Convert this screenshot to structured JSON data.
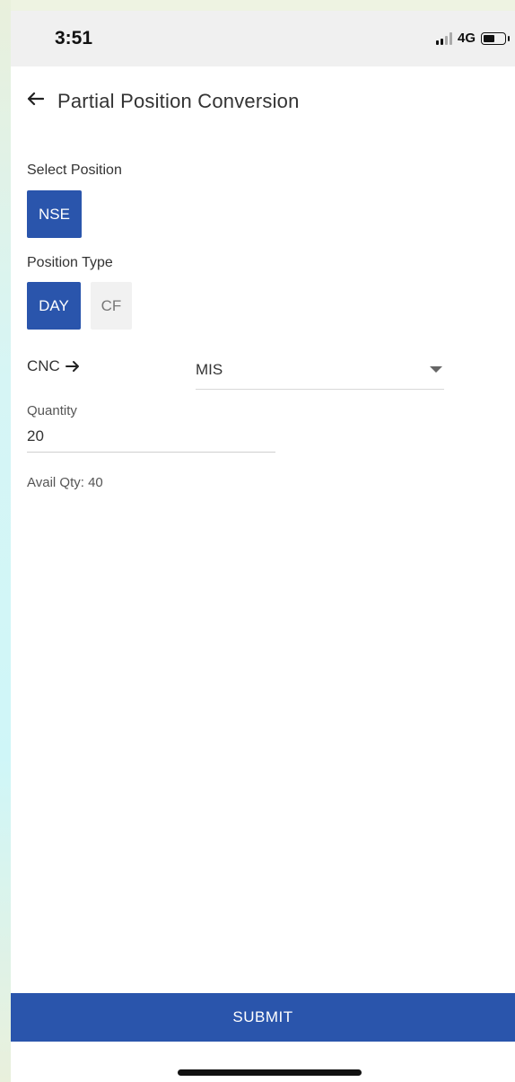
{
  "status_bar": {
    "time": "3:51",
    "network": "4G",
    "battery_level": 0.55
  },
  "header": {
    "back_icon": "arrow-left-icon",
    "title": "Partial Position Conversion"
  },
  "select_position": {
    "label": "Select Position",
    "options": [
      "NSE"
    ],
    "selected": "NSE"
  },
  "position_type": {
    "label": "Position Type",
    "options": [
      "DAY",
      "CF"
    ],
    "selected": "DAY"
  },
  "conversion": {
    "from": "CNC",
    "arrow_icon": "arrow-right-icon",
    "to_selected": "MIS",
    "caret_icon": "caret-down-icon"
  },
  "quantity": {
    "label": "Quantity",
    "value": "20"
  },
  "avail_qty": "Avail Qty: 40",
  "submit_label": "SUBMIT",
  "colors": {
    "primary": "#2a55ac",
    "chip_inactive_bg": "#f1f1f1",
    "status_bar_bg": "#f0f0f0"
  }
}
